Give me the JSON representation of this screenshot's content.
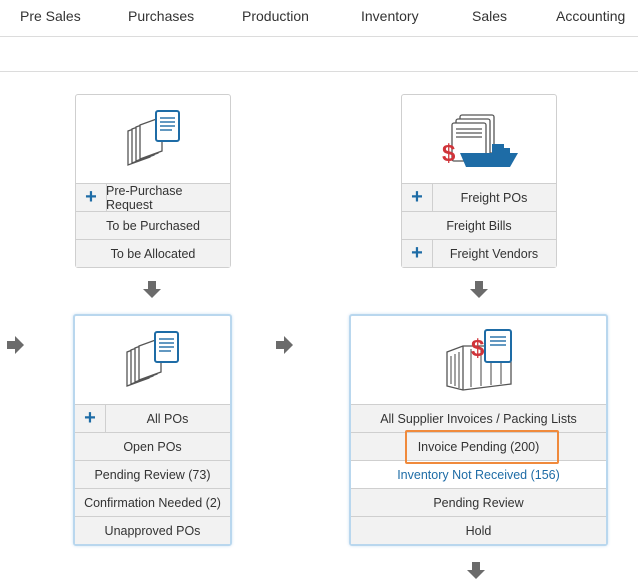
{
  "nav": {
    "items": [
      "Pre Sales",
      "Purchases",
      "Production",
      "Inventory",
      "Sales",
      "Accounting"
    ]
  },
  "panels": {
    "pre_purchase": {
      "icon": "documents-icon",
      "rows": [
        {
          "label": "Pre-Purchase Request",
          "plus": "+"
        },
        {
          "label": "To be Purchased"
        },
        {
          "label": "To be Allocated"
        }
      ]
    },
    "freight": {
      "icon": "freight-ship-icon",
      "rows": [
        {
          "label": "Freight POs",
          "plus": "+"
        },
        {
          "label": "Freight Bills"
        },
        {
          "label": "Freight Vendors",
          "plus": "+"
        }
      ]
    },
    "purchase_orders": {
      "icon": "documents-icon",
      "rows": [
        {
          "label": "All POs",
          "plus": "+"
        },
        {
          "label": "Open POs"
        },
        {
          "label": "Pending Review (73)"
        },
        {
          "label": "Confirmation Needed (2)"
        },
        {
          "label": "Unapproved POs"
        }
      ]
    },
    "supplier_invoices": {
      "icon": "container-invoice-icon",
      "rows": [
        {
          "label": "All Supplier Invoices / Packing Lists"
        },
        {
          "label": "Invoice Pending (200)"
        },
        {
          "label": "Inventory Not Received (156)"
        },
        {
          "label": "Pending Review"
        },
        {
          "label": "Hold"
        }
      ]
    }
  },
  "colors": {
    "accent_blue": "#1e6ca6",
    "dollar_red": "#d0343a",
    "highlight_orange": "#f08a3c",
    "arrow_gray": "#6b6b6b"
  }
}
